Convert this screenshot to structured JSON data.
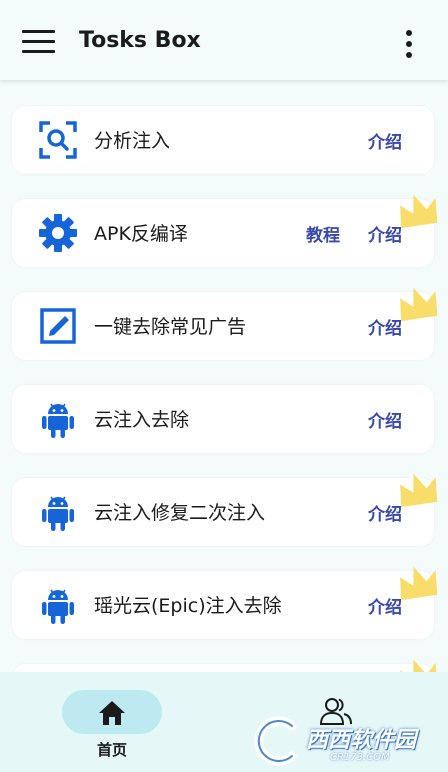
{
  "app": {
    "title": "Tosks Box"
  },
  "colors": {
    "accent": "#1565d8",
    "link": "#3949ab",
    "ribbon": "#f9dd6a",
    "nav_active": "#bde9f1"
  },
  "cards": [
    {
      "label": "分析注入",
      "icon": "search-scan-icon",
      "intro": "介绍"
    },
    {
      "label": "APK反编译",
      "icon": "gear-icon",
      "tutorial": "教程",
      "intro": "介绍"
    },
    {
      "label": "一键去除常见广告",
      "icon": "edit-box-icon",
      "intro": "介绍"
    },
    {
      "label": "云注入去除",
      "icon": "android-icon",
      "intro": "介绍"
    },
    {
      "label": "云注入修复二次注入",
      "icon": "android-icon",
      "intro": "介绍"
    },
    {
      "label": "瑶光云(Epic)注入去除",
      "icon": "android-icon",
      "intro": "介绍"
    }
  ],
  "bottom_nav": {
    "home": {
      "label": "首页",
      "icon": "home-icon",
      "active": true
    },
    "users": {
      "icon": "users-icon",
      "active": false
    }
  },
  "watermark": {
    "text": "西西软件园",
    "url": "CR173.COM"
  }
}
